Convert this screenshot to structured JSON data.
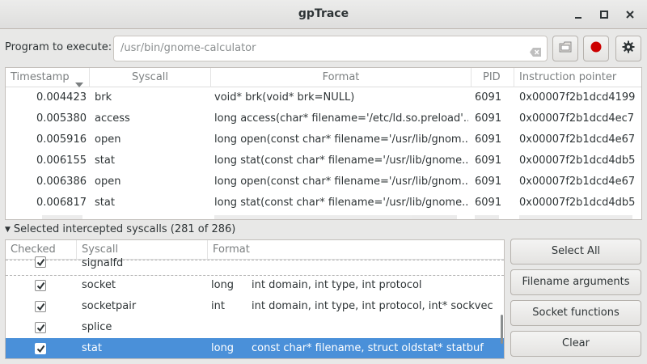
{
  "window": {
    "title": "gpTrace"
  },
  "program": {
    "label": "Program to execute:",
    "path": "/usr/bin/gnome-calculator"
  },
  "trace_table": {
    "columns": [
      "Timestamp",
      "Syscall",
      "Format",
      "PID",
      "Instruction pointer"
    ],
    "rows": [
      [
        "0.004423",
        "brk",
        "void* brk(void* brk=NULL)",
        "6091",
        "0x00007f2b1dcd4199"
      ],
      [
        "0.005380",
        "access",
        "long access(char* filename='/etc/ld.so.preload'...",
        "6091",
        "0x00007f2b1dcd4ec7"
      ],
      [
        "0.005916",
        "open",
        "long open(const char* filename='/usr/lib/gnom...",
        "6091",
        "0x00007f2b1dcd4e67"
      ],
      [
        "0.006155",
        "stat",
        "long stat(const char* filename='/usr/lib/gnome...",
        "6091",
        "0x00007f2b1dcd4db5"
      ],
      [
        "0.006386",
        "open",
        "long open(const char* filename='/usr/lib/gnom...",
        "6091",
        "0x00007f2b1dcd4e67"
      ],
      [
        "0.006817",
        "stat",
        "long stat(const char* filename='/usr/lib/gnome...",
        "6091",
        "0x00007f2b1dcd4db5"
      ]
    ]
  },
  "expander": {
    "label": "Selected intercepted syscalls (281 of 286)"
  },
  "syscall_table": {
    "columns": [
      "Checked",
      "Syscall",
      "Format"
    ],
    "rows": [
      {
        "checked": true,
        "name": "signalfd",
        "ret": "",
        "args": ""
      },
      {
        "checked": true,
        "name": "socket",
        "ret": "long",
        "args": "int domain, int type, int protocol"
      },
      {
        "checked": true,
        "name": "socketpair",
        "ret": "int",
        "args": "int domain, int type, int protocol, int* sockvec"
      },
      {
        "checked": true,
        "name": "splice",
        "ret": "",
        "args": ""
      },
      {
        "checked": true,
        "name": "stat",
        "ret": "long",
        "args": "const char* filename, struct oldstat* statbuf",
        "selected": true
      }
    ]
  },
  "buttons": {
    "select_all": "Select All",
    "filename_args": "Filename arguments",
    "socket_functions": "Socket functions",
    "clear": "Clear"
  },
  "colors": {
    "selection": "#4a90d9",
    "record": "#cc0000"
  }
}
